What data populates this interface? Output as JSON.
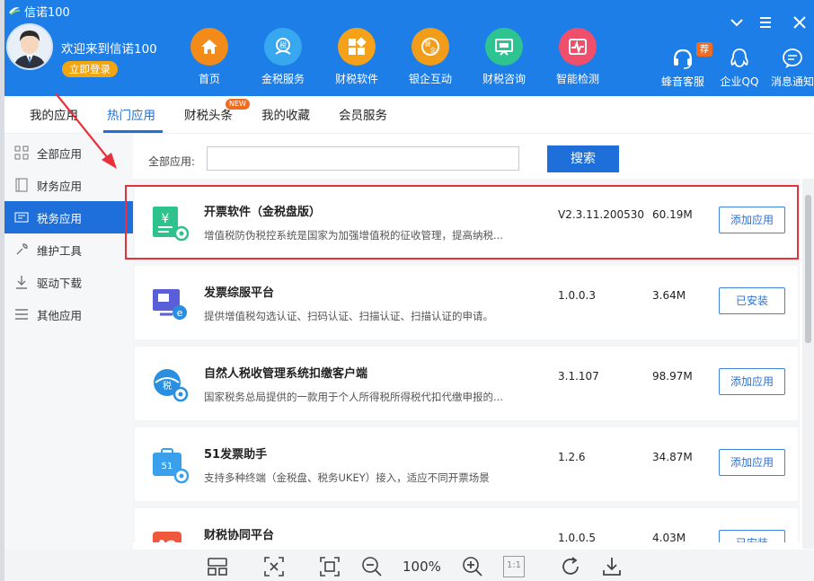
{
  "app": {
    "title": "信诺100",
    "welcome": "欢迎来到信诺100",
    "login_label": "立即登录"
  },
  "window_controls": [
    "⌄",
    "≡",
    "✕"
  ],
  "nav": [
    {
      "label": "首页",
      "icon": "home-icon",
      "color": "#f28b1a"
    },
    {
      "label": "金税服务",
      "icon": "tax-service-icon",
      "color": "#37a7f0"
    },
    {
      "label": "财税软件",
      "icon": "software-icon",
      "color": "#f5a21a"
    },
    {
      "label": "银企互动",
      "icon": "bank-enterprise-icon",
      "color": "#f29d1a"
    },
    {
      "label": "财税咨询",
      "icon": "consult-icon",
      "color": "#2ec491"
    },
    {
      "label": "智能检测",
      "icon": "detect-icon",
      "color": "#ef4f6b"
    }
  ],
  "tools": [
    {
      "label": "蜂音客服",
      "icon": "headset-icon",
      "badge": "荐"
    },
    {
      "label": "企业QQ",
      "icon": "qq-icon"
    },
    {
      "label": "消息通知",
      "icon": "message-icon"
    }
  ],
  "tabs": [
    {
      "label": "我的应用",
      "active": false
    },
    {
      "label": "热门应用",
      "active": true
    },
    {
      "label": "财税头条",
      "active": false,
      "badge": "NEW"
    },
    {
      "label": "我的收藏",
      "active": false
    },
    {
      "label": "会员服务",
      "active": false
    }
  ],
  "sidebar": [
    {
      "label": "全部应用",
      "icon": "grid-icon",
      "active": false
    },
    {
      "label": "财务应用",
      "icon": "book-icon",
      "active": false
    },
    {
      "label": "税务应用",
      "icon": "tax-card-icon",
      "active": true
    },
    {
      "label": "维护工具",
      "icon": "wrench-icon",
      "active": false
    },
    {
      "label": "驱动下载",
      "icon": "download-icon",
      "active": false
    },
    {
      "label": "其他应用",
      "icon": "list-icon",
      "active": false
    }
  ],
  "search": {
    "label": "全部应用:",
    "value": "",
    "button": "搜索"
  },
  "apps": [
    {
      "title": "开票软件（金税盘版）",
      "desc": "增值税防伪税控系统是国家为加强增值税的征收管理，提高纳税...",
      "version": "V2.3.11.200530",
      "size": "60.19M",
      "action": "添加应用",
      "icon": "invoice-yuan-icon"
    },
    {
      "title": "发票综服平台",
      "desc": "提供增值税勾选认证、扫码认证、扫描认证、扫描认证的申请。",
      "version": "1.0.0.3",
      "size": "3.64M",
      "action": "已安装",
      "icon": "invoice-platform-icon"
    },
    {
      "title": "自然人税收管理系统扣缴客户端",
      "desc": "国家税务总局提供的一款用于个人所得税所得税代扣代缴申报的...",
      "version": "3.1.107",
      "size": "98.97M",
      "action": "添加应用",
      "icon": "tax-globe-icon"
    },
    {
      "title": "51发票助手",
      "desc": "支持多种终端（金税盘、税务UKEY）接入，适应不同开票场景",
      "version": "1.2.6",
      "size": "34.87M",
      "action": "添加应用",
      "icon": "51-invoice-icon"
    },
    {
      "title": "财税协同平台",
      "desc": "",
      "version": "1.0.0.5",
      "size": "4.03M",
      "action": "已安装",
      "icon": "cooperate-icon"
    }
  ],
  "viewer": {
    "zoom": "100%",
    "one_to_one": "1:1"
  },
  "colors": {
    "header": "#1e7ee8",
    "accent": "#1e6fd9",
    "highlight": "#e8313a"
  }
}
